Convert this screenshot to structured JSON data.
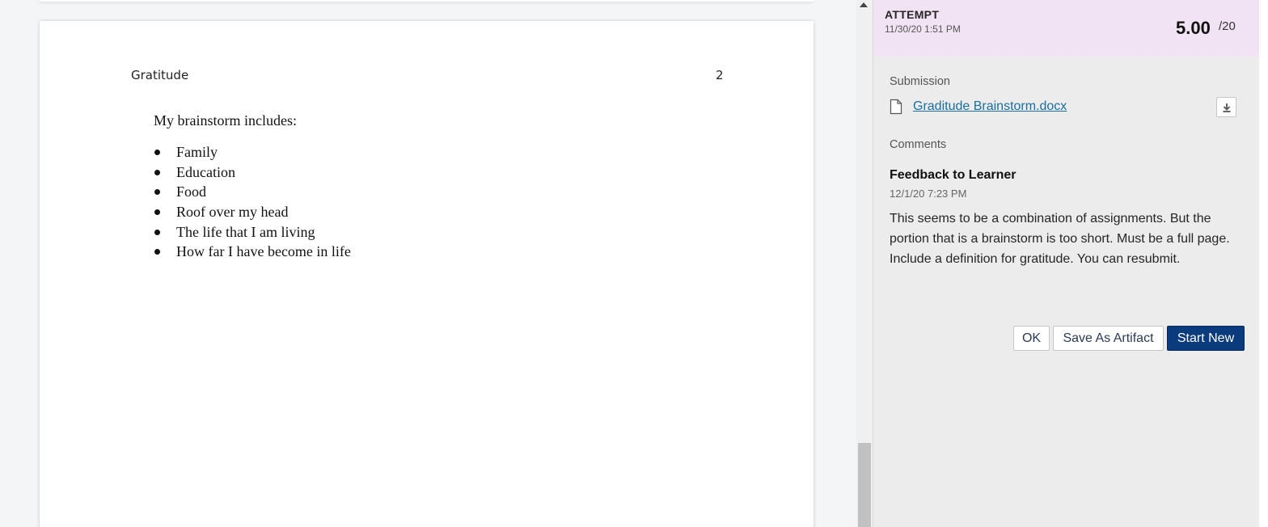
{
  "document": {
    "header_title": "Gratitude",
    "page_number": "2",
    "intro": "My brainstorm includes:",
    "bullets": [
      "Family",
      "Education",
      "Food",
      "Roof over my head",
      "The life that I am living",
      "How far I have become in life"
    ]
  },
  "attempt": {
    "label": "ATTEMPT",
    "date": "11/30/20 1:51 PM",
    "score": "5.00",
    "score_max": "/20"
  },
  "submission": {
    "label": "Submission",
    "file_name": "Graditude Brainstorm.docx",
    "file_icon": "document-icon",
    "download_icon": "download-icon"
  },
  "comments": {
    "label": "Comments",
    "feedback_title": "Feedback to Learner",
    "feedback_date": "12/1/20 7:23 PM",
    "feedback_body": "This seems to be a combination of assignments. But the portion that is a brainstorm is too short. Must be a full page. Include a definition for gratitude. You can resubmit."
  },
  "actions": {
    "ok_label": "OK",
    "save_artifact_label": "Save As Artifact",
    "start_new_label": "Start New"
  },
  "colors": {
    "attempt_bar": "#f2e3f4",
    "link": "#1a6e9e",
    "primary_button": "#0a3b7c",
    "panel_bg": "#ececec"
  }
}
